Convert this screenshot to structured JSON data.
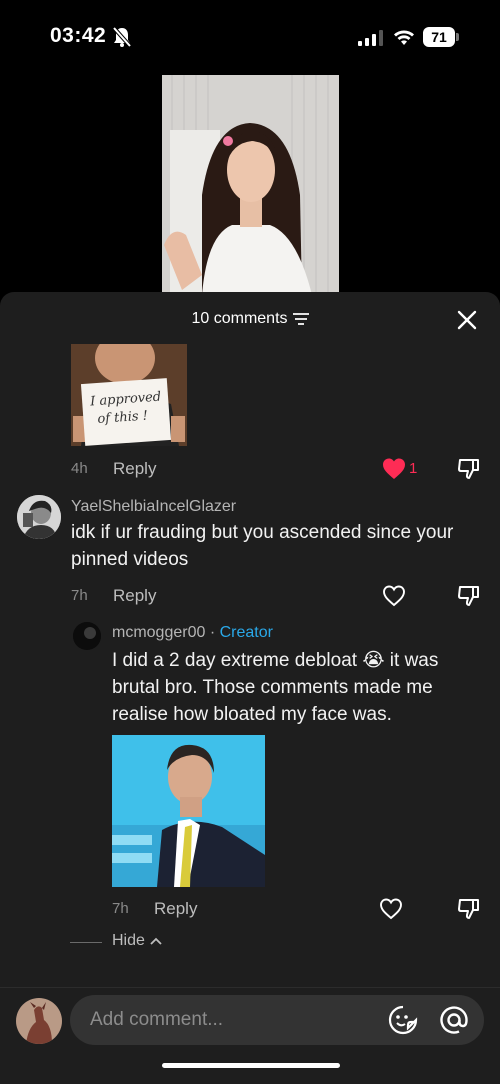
{
  "status": {
    "time": "03:42",
    "battery": "71"
  },
  "sheet": {
    "comment_count": "10 comments"
  },
  "image_comment": {
    "sign_line1": "I approved",
    "sign_line2": "of this !",
    "time": "4h",
    "reply_label": "Reply",
    "like_count": "1"
  },
  "comment": {
    "username": "YaelShelbiaIncelGlazer",
    "text": "idk if ur frauding but you ascended since your pinned videos",
    "time": "7h",
    "reply_label": "Reply"
  },
  "reply": {
    "username": "mcmogger00",
    "separator": " · ",
    "badge": "Creator",
    "text": "I did a 2 day extreme debloat 😭 it was brutal bro. Those comments made me realise how bloated my face was.",
    "time": "7h",
    "reply_label": "Reply"
  },
  "hide_label": "Hide",
  "input": {
    "placeholder": "Add comment..."
  },
  "colors": {
    "like": "#fe2c55",
    "creator": "#2aa8e8",
    "sheet_bg": "#1e1e1e"
  }
}
